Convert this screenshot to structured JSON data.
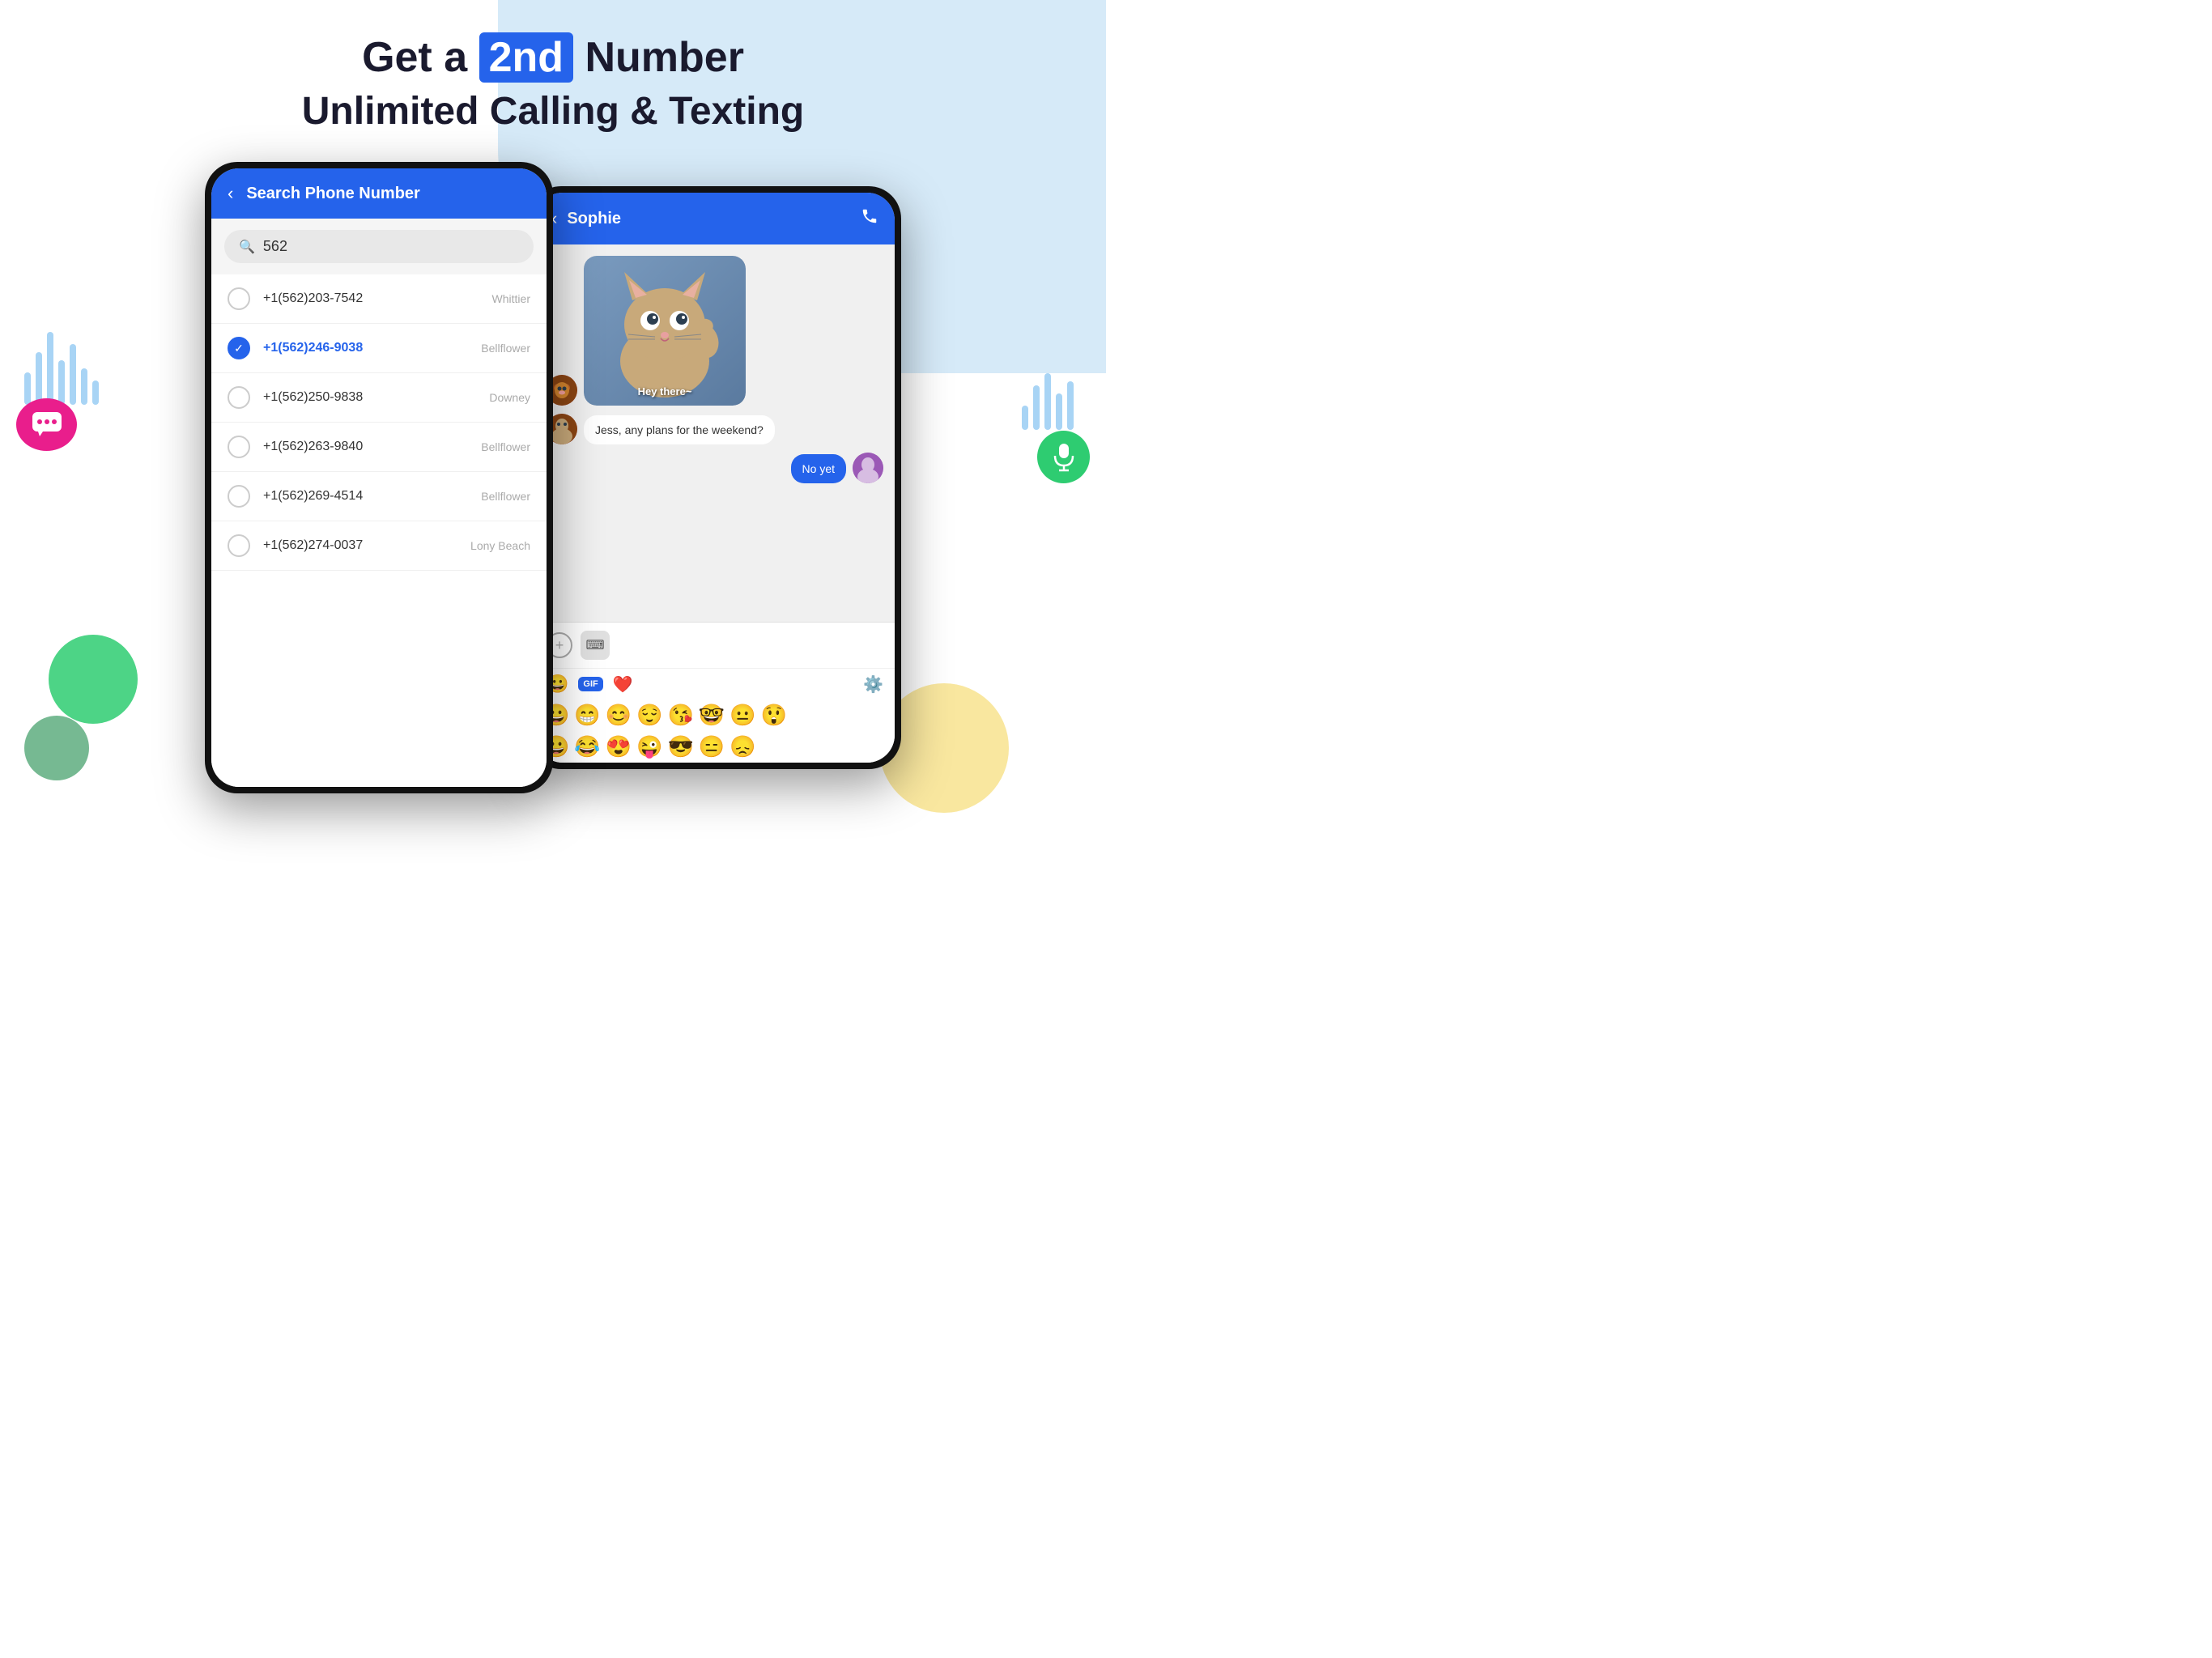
{
  "page": {
    "background": "#ffffff"
  },
  "header": {
    "line1_prefix": "Get a ",
    "line1_highlight": "2nd",
    "line1_suffix": " Number",
    "line2": "Unlimited Calling & Texting"
  },
  "phone_left": {
    "screen_title": "Search Phone Number",
    "search_value": "562",
    "numbers": [
      {
        "number": "+1(562)203-7542",
        "city": "Whittier",
        "selected": false
      },
      {
        "number": "+1(562)246-9038",
        "city": "Bellflower",
        "selected": true
      },
      {
        "number": "+1(562)250-9838",
        "city": "Downey",
        "selected": false
      },
      {
        "number": "+1(562)263-9840",
        "city": "Bellflower",
        "selected": false
      },
      {
        "number": "+1(562)269-4514",
        "city": "Bellflower",
        "selected": false
      },
      {
        "number": "+1(562)274-0037",
        "city": "Lony Beach",
        "selected": false
      }
    ]
  },
  "phone_right": {
    "contact_name": "Sophie",
    "messages": [
      {
        "type": "incoming",
        "content_type": "image",
        "caption": "Hey there~"
      },
      {
        "type": "incoming",
        "content_type": "text",
        "text": "Jess, any plans for the weekend?"
      },
      {
        "type": "outgoing",
        "content_type": "text",
        "text": "No yet"
      }
    ],
    "emoji_toolbar": {
      "gif_label": "GIF"
    },
    "emojis_row1": [
      "😀",
      "😁",
      "😊",
      "😌",
      "😘",
      "🤓",
      "😐",
      "😲"
    ],
    "emojis_row2": [
      "😀",
      "😂",
      "😍",
      "😜",
      "😎",
      "😑",
      "😞"
    ]
  },
  "decorative": {
    "wave_bars": [
      40,
      65,
      90,
      55,
      75,
      45,
      30
    ],
    "wave_bars_right": [
      30,
      55,
      70,
      45,
      60
    ]
  }
}
